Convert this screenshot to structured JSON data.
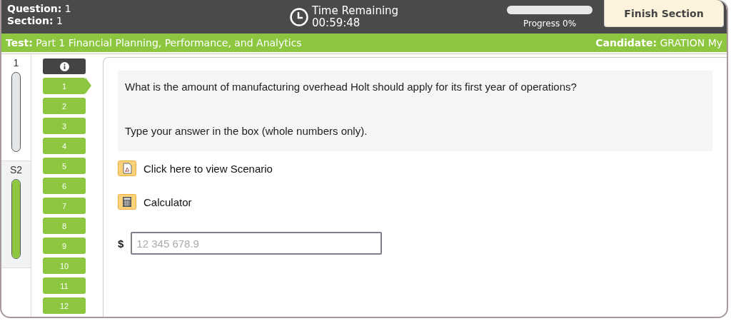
{
  "header": {
    "question_label": "Question:",
    "question": "1",
    "section_label": "Section:",
    "section": "1",
    "timer_label": "Time Remaining",
    "timer": "00:59:48",
    "progress": {
      "level": 0,
      "label": "Progress 0%"
    },
    "finish_button": "Finish Section"
  },
  "info_bar": {
    "test_label": "Test:",
    "test": "Part 1 Financial Planning, Performance, and Analytics",
    "candidate_label": "Candidate:",
    "candidate": "GRATION My"
  },
  "sections": [
    {
      "label": "1",
      "selected": true,
      "level": 0
    },
    {
      "label": "S2",
      "selected": false,
      "level": 1
    }
  ],
  "questions": [
    {
      "label": "1",
      "selected": true
    },
    {
      "label": "2",
      "selected": false
    },
    {
      "label": "3",
      "selected": false
    },
    {
      "label": "4",
      "selected": false
    },
    {
      "label": "5",
      "selected": false
    },
    {
      "label": "6",
      "selected": false
    },
    {
      "label": "7",
      "selected": false
    },
    {
      "label": "8",
      "selected": false
    },
    {
      "label": "9",
      "selected": false
    },
    {
      "label": "10",
      "selected": false
    },
    {
      "label": "11",
      "selected": false
    },
    {
      "label": "12",
      "selected": false
    }
  ],
  "question_text": [
    "What is the amount of manufacturing overhead Holt should apply for its first year of operations?",
    "Type your answer in the box (whole numbers only)."
  ],
  "tools": [
    {
      "kind": "pdf",
      "label": "Click here to view Scenario"
    },
    {
      "kind": "calculator",
      "label": "Calculator"
    }
  ],
  "answer": {
    "currency": "$",
    "placeholder": "12 345 678.9"
  }
}
